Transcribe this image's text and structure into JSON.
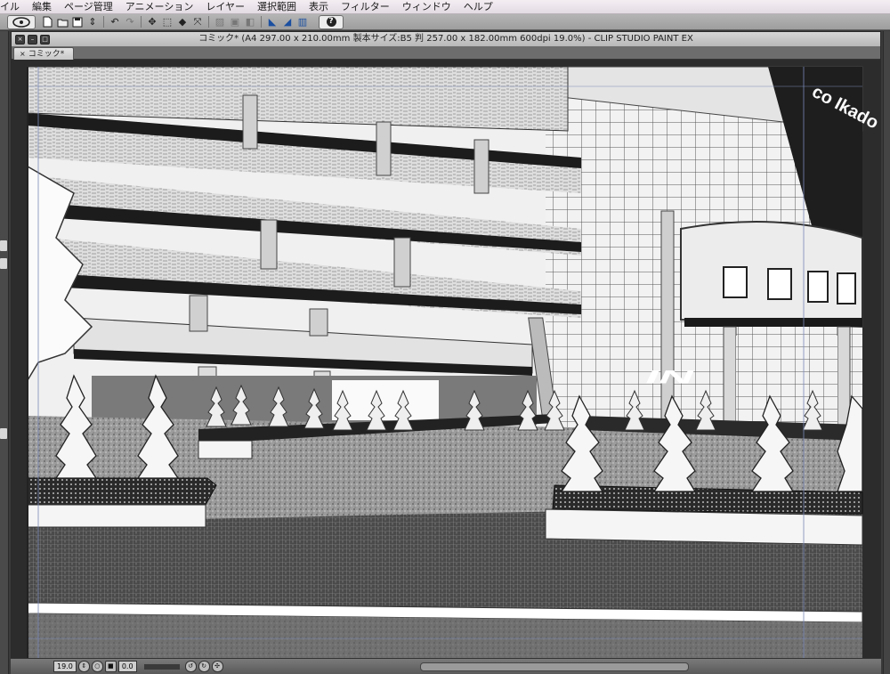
{
  "menu": [
    "イル",
    "編集",
    "ページ管理",
    "アニメーション",
    "レイヤー",
    "選択範囲",
    "表示",
    "フィルター",
    "ウィンドウ",
    "ヘルプ"
  ],
  "document": {
    "title": "コミック* (A4 297.00 x 210.00mm 製本サイズ:B5 判 257.00 x 182.00mm 600dpi 19.0%)  - CLIP STUDIO PAINT EX",
    "tab_label": "コミック*",
    "sign_text": "co Ikado",
    "road_marking": "IN"
  },
  "status": {
    "zoom": "19.0",
    "angle": "0.0"
  },
  "icons": {
    "app": "clip-studio-logo-icon",
    "new": "new-file-icon",
    "open": "open-folder-icon",
    "save": "save-icon",
    "undo": "undo-icon",
    "redo": "redo-icon",
    "help": "help-icon"
  }
}
